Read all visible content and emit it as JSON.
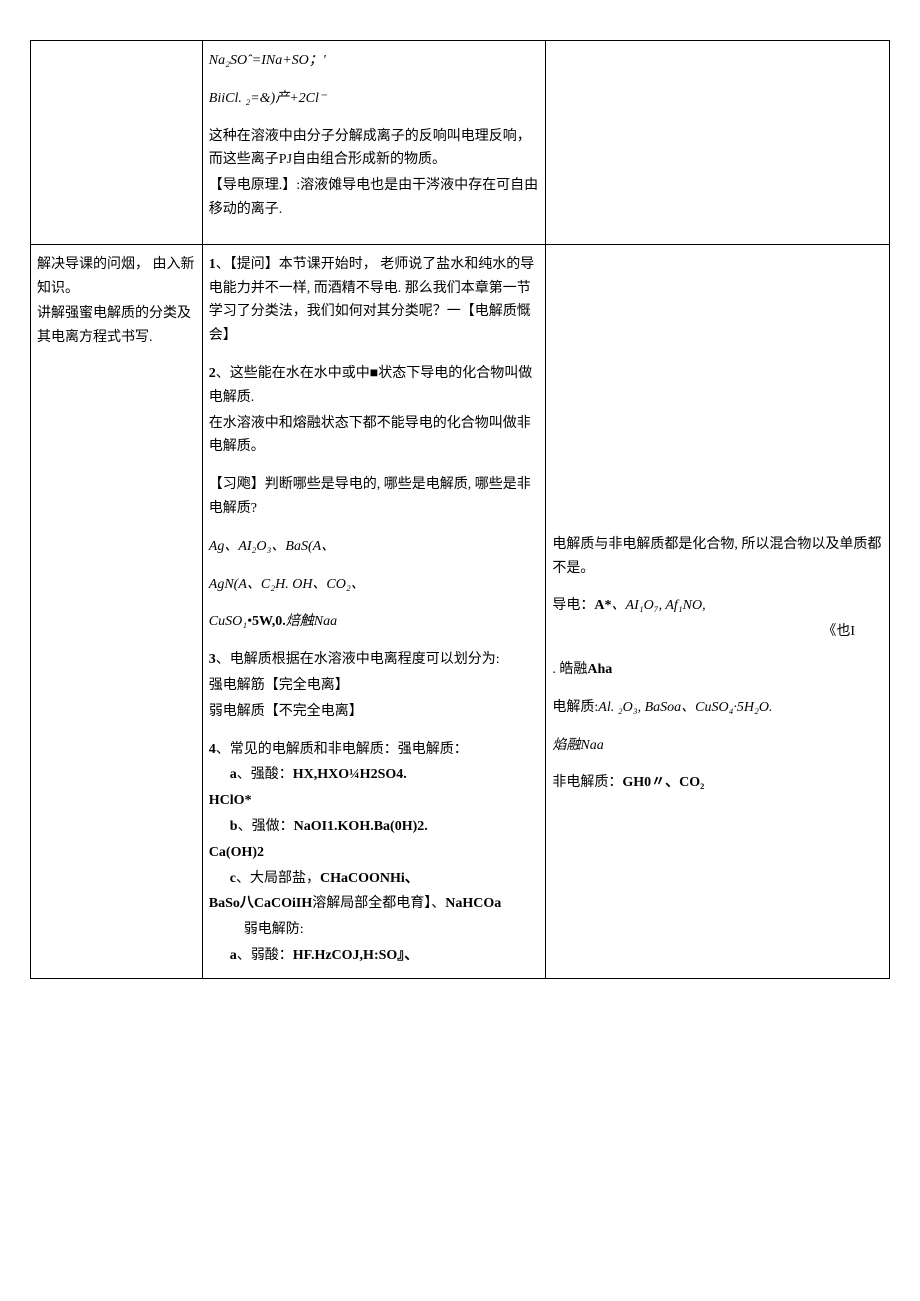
{
  "row1": {
    "col1": "",
    "col2": {
      "eq1": "Na₂SOˆ=INa+SO；'",
      "eq2": "BiiCl. ₂=&)产+2Cl⁻",
      "p1": "这种在溶液中由分子分解成离子的反响叫电理反响，而这些离子PJ自由组合形成新的物质。",
      "p2": "【导电原理.】:溶液傩导电也是由干涔液中存在可自由移动的离子."
    },
    "col3": ""
  },
  "row2": {
    "col1": {
      "p1": "解决导课的问烟， 由入新知识。",
      "p2": "讲解强蜜电解质的分类及其电离方程式书写."
    },
    "col2": {
      "p1a": "1",
      "p1b": "、【提问】本节课开始时， 老师说了盐水和纯水的导电能力并不一样, 而酒精不导电. 那么我们本章第一节学习了分类法，我们如何对其分类呢？一【电解质慨会】",
      "p2a": "2",
      "p2b": "、这些能在水在水中或中■状态下导电的化合物叫做电解质.",
      "p2c": "在水溶液中和熔融状态下都不能导电的化合物叫做非电解质。",
      "p3": "【习飑】判断哪些是导电的, 哪些是电解质, 哪些是非电解质?",
      "p4": "Ag、AI₂O₃、BaS(A、",
      "p5": "AgN(A、C₂H. OH、CO₂、",
      "p6a": "CuSO₁•",
      "p6b": "5W,0.",
      "p6c": "焙触Naa",
      "p7a": "3",
      "p7b": "、电解质根据在水溶液中电离程度可以划分为:",
      "p7c": "强电解筋【完全电离】",
      "p7d": "弱电解质【不完全电离】",
      "p8a": "4",
      "p8b": "、常见的电解质和非电解质：强电解质：",
      "p8c_a": "a",
      "p8c_b": "、强酸：",
      "p8c_c": "HX,HXO¼H2SO4.",
      "p8d": "HClO*",
      "p8e_a": "b",
      "p8e_b": "、强做：",
      "p8e_c": "NaOI1.KOH.Ba(0H)2.",
      "p8f": "Ca(OH)2",
      "p8g_a": "c",
      "p8g_b": "、大局部盐，",
      "p8g_c": "CHaCOONHi、",
      "p8h_a": "BaSo八CaCOiIH",
      "p8h_b": "溶解局部全都电育】、",
      "p8h_c": "NaHCOa",
      "p8i": "弱电解防:",
      "p8j_a": "a",
      "p8j_b": "、弱酸：",
      "p8j_c": "HF.HzCOJ,H:SO』、"
    },
    "col3": {
      "p1": "电解质与非电解质都是化合物, 所以混合物以及单质都不是。",
      "p2a": "导电：",
      "p2b": "A*",
      "p2c": "、AI₁O₇, Af₁NO,",
      "p3": "《也I",
      "p4a": ". 皓融",
      "p4b": "Aha",
      "p5a": "电解质:",
      "p5b": "Al. ₂O₃, BaSoa、CuSO₄·5H₂O.",
      "p6": "焰融Naa",
      "p7a": "非电解质：",
      "p7b": "GH0〃、CO₂"
    }
  }
}
